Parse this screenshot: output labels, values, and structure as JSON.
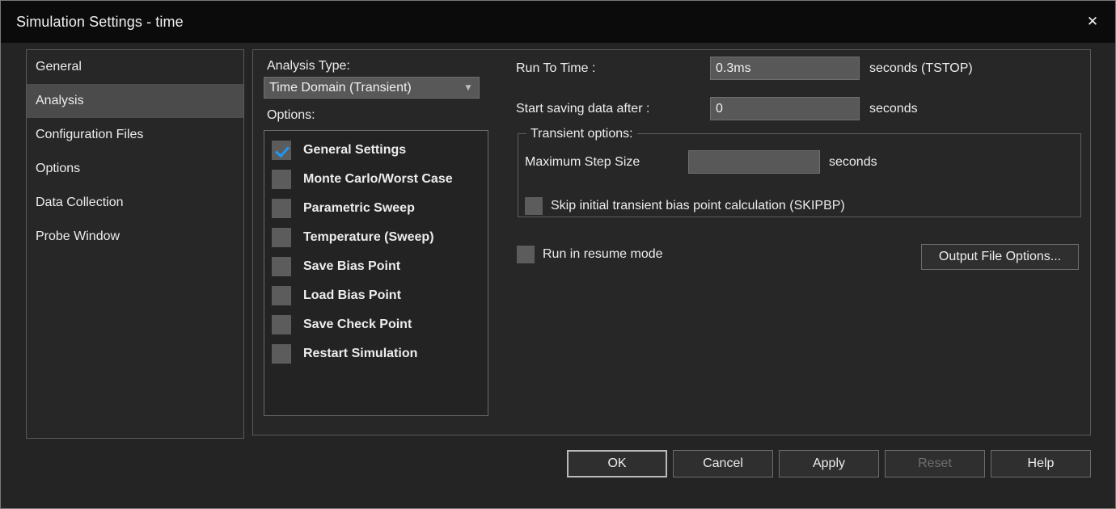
{
  "window": {
    "title": "Simulation Settings - time",
    "close_icon": "close-icon"
  },
  "sidebar": {
    "items": [
      {
        "label": "General",
        "selected": false
      },
      {
        "label": "Analysis",
        "selected": true
      },
      {
        "label": "Configuration Files",
        "selected": false
      },
      {
        "label": "Options",
        "selected": false
      },
      {
        "label": "Data Collection",
        "selected": false
      },
      {
        "label": "Probe Window",
        "selected": false
      }
    ]
  },
  "analysis": {
    "type_label": "Analysis Type:",
    "type_value": "Time Domain (Transient)",
    "type_arrow_icon": "chevron-down-icon",
    "options_label": "Options:",
    "options": [
      {
        "label": "General Settings",
        "checked": true
      },
      {
        "label": "Monte Carlo/Worst Case",
        "checked": false
      },
      {
        "label": "Parametric Sweep",
        "checked": false
      },
      {
        "label": "Temperature (Sweep)",
        "checked": false
      },
      {
        "label": "Save Bias Point",
        "checked": false
      },
      {
        "label": "Load Bias Point",
        "checked": false
      },
      {
        "label": "Save Check Point",
        "checked": false
      },
      {
        "label": "Restart Simulation",
        "checked": false
      }
    ]
  },
  "settings": {
    "run_to_time_label": "Run To Time :",
    "run_to_time_value": "0.3ms",
    "run_to_time_suffix": "seconds (TSTOP)",
    "start_saving_label": "Start saving data after :",
    "start_saving_value": "0",
    "start_saving_suffix": "seconds",
    "transient_group_title": "Transient options:",
    "max_step_label": "Maximum Step Size",
    "max_step_value": "",
    "max_step_suffix": "seconds",
    "skipbp_label": "Skip initial transient bias point calculation (SKIPBP)",
    "skipbp_checked": false,
    "resume_label": "Run in resume mode",
    "resume_checked": false,
    "output_file_options_label": "Output File Options..."
  },
  "buttons": {
    "ok": "OK",
    "cancel": "Cancel",
    "apply": "Apply",
    "reset": "Reset",
    "help": "Help"
  },
  "colors": {
    "accent_check": "#2196f3",
    "panel_bg": "#262726",
    "window_bg": "#232423",
    "titlebar_bg": "#0b0b0b",
    "input_bg": "#575857",
    "selected_item_bg": "#4a4b4a"
  }
}
